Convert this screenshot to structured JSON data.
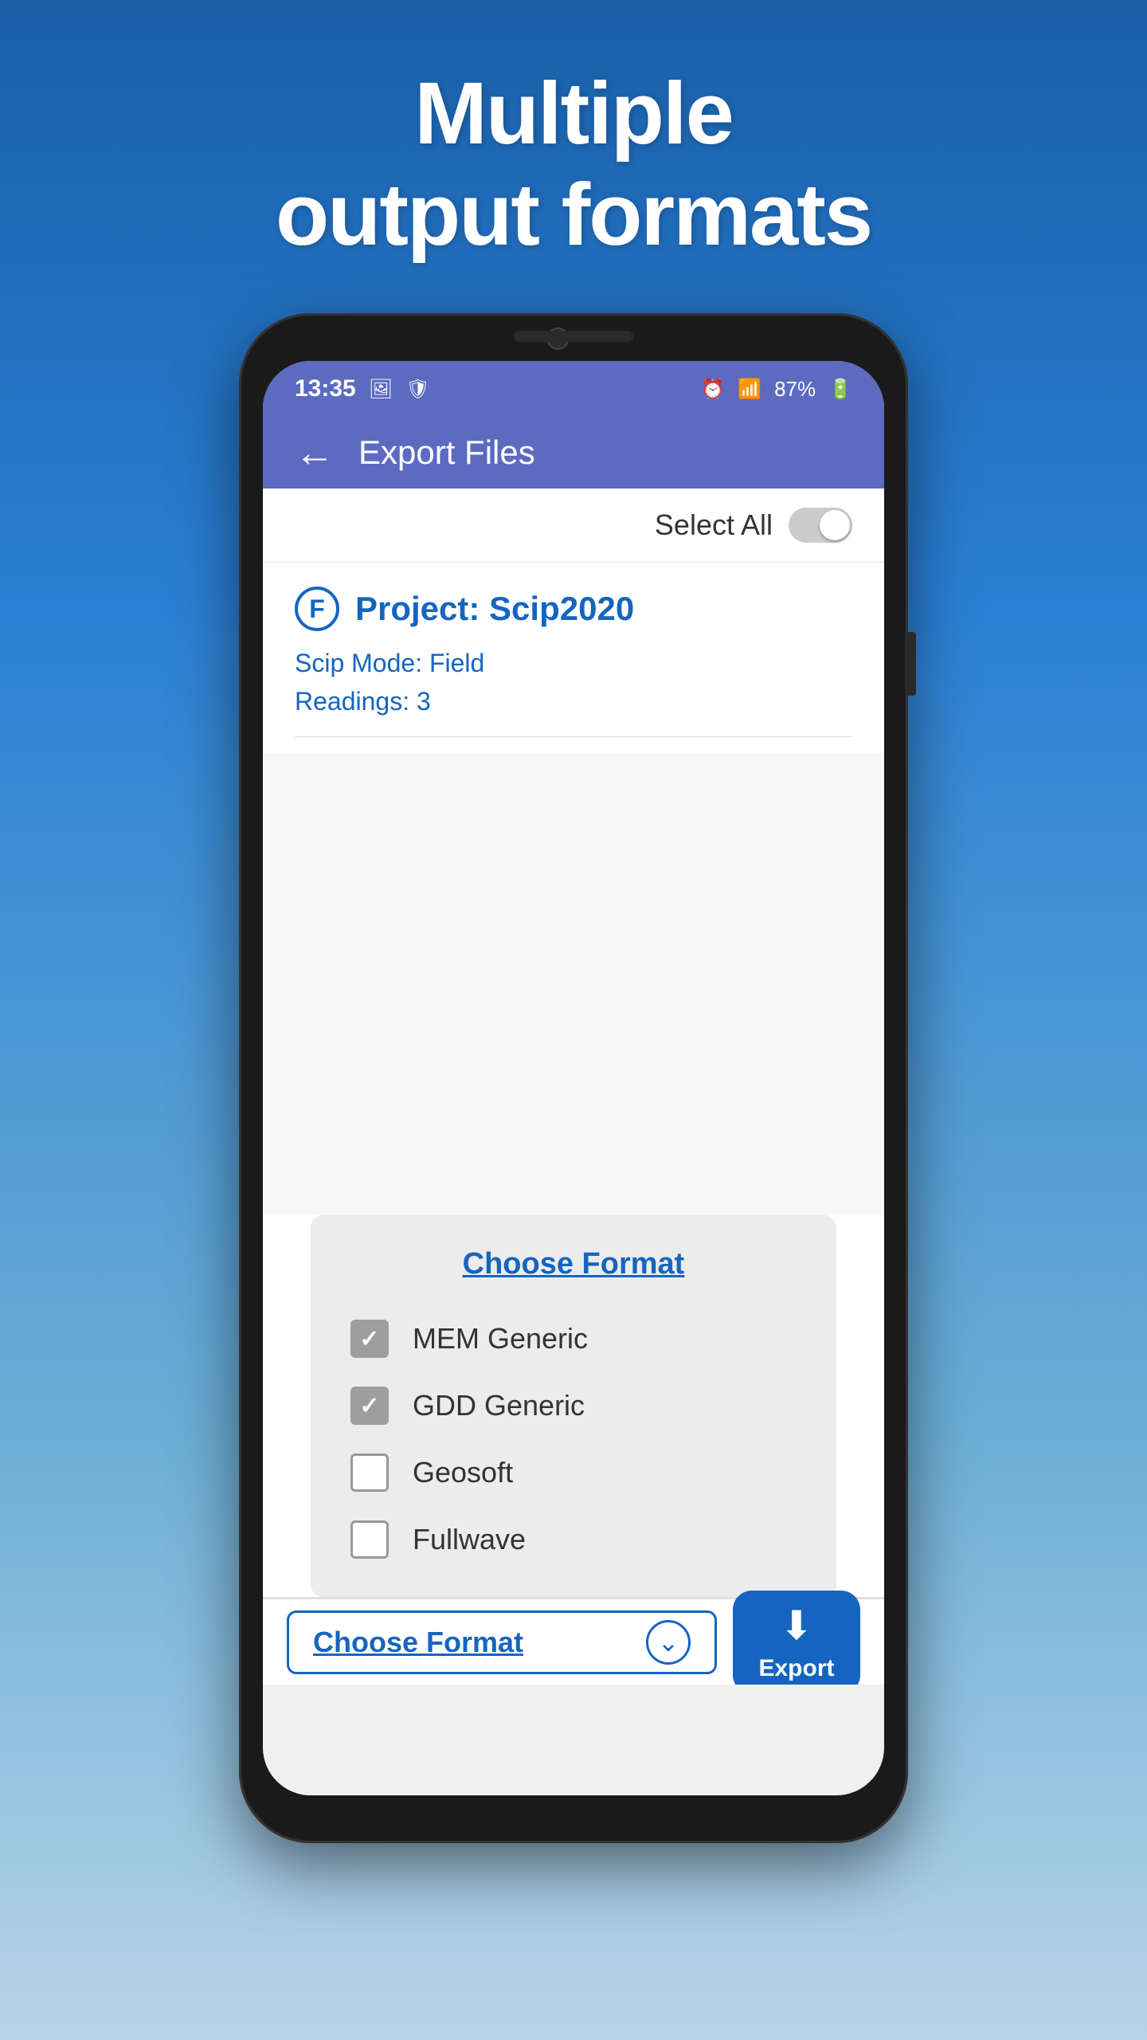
{
  "hero": {
    "line1": "Multiple",
    "line2": "output formats"
  },
  "status_bar": {
    "time": "13:35",
    "battery": "87%",
    "icons": [
      "image",
      "shield",
      "alarm",
      "wifi",
      "signal"
    ]
  },
  "app_bar": {
    "title": "Export Files",
    "back_label": "←"
  },
  "select_all": {
    "label": "Select All"
  },
  "project": {
    "icon_letter": "F",
    "name": "Project: Scip2020",
    "mode": "Scip Mode: Field",
    "readings": "Readings: 3"
  },
  "format_panel": {
    "title": "Choose Format",
    "formats": [
      {
        "label": "MEM Generic",
        "checked": true
      },
      {
        "label": "GDD Generic",
        "checked": true
      },
      {
        "label": "Geosoft",
        "checked": false
      },
      {
        "label": "Fullwave",
        "checked": false
      }
    ]
  },
  "bottom_bar": {
    "choose_format_label": "Choose Format",
    "export_label": "Export"
  }
}
